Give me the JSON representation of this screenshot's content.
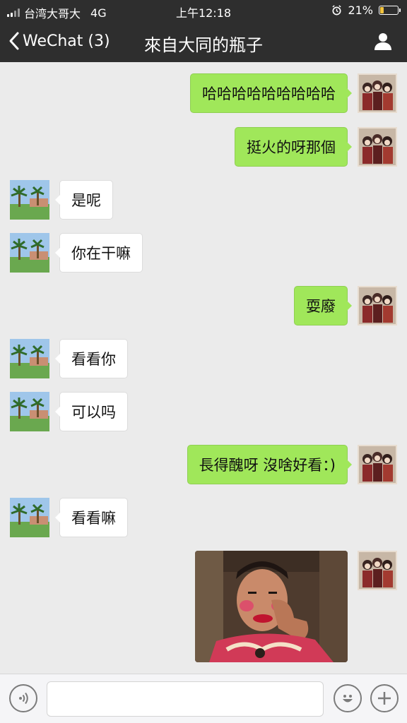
{
  "status": {
    "carrier": "台湾大哥大",
    "network": "4G",
    "time": "上午12:18",
    "battery": "21%",
    "battery_level": 0.21
  },
  "nav": {
    "back_label": "WeChat (3)",
    "title": "來自大同的瓶子"
  },
  "messages": [
    {
      "side": "out",
      "text": "哈哈哈哈哈哈哈哈哈"
    },
    {
      "side": "out",
      "text": "挺火的呀那個"
    },
    {
      "side": "in",
      "text": "是呢"
    },
    {
      "side": "in",
      "text": "你在干嘛"
    },
    {
      "side": "out",
      "text": "耍廢"
    },
    {
      "side": "in",
      "text": "看看你"
    },
    {
      "side": "in",
      "text": "可以吗"
    },
    {
      "side": "out",
      "text": "長得醜呀 沒啥好看：)"
    },
    {
      "side": "in",
      "text": "看看嘛"
    },
    {
      "side": "out",
      "type": "image"
    }
  ],
  "input": {
    "placeholder": ""
  },
  "icons": {
    "voice": "voice-icon",
    "emoji": "emoji-icon",
    "add": "plus-icon",
    "back": "chevron-left-icon",
    "profile": "person-icon"
  },
  "colors": {
    "header": "#2e2e2e",
    "background": "#ebebeb",
    "outgoing_bubble": "#a0e75a",
    "incoming_bubble": "#ffffff"
  }
}
